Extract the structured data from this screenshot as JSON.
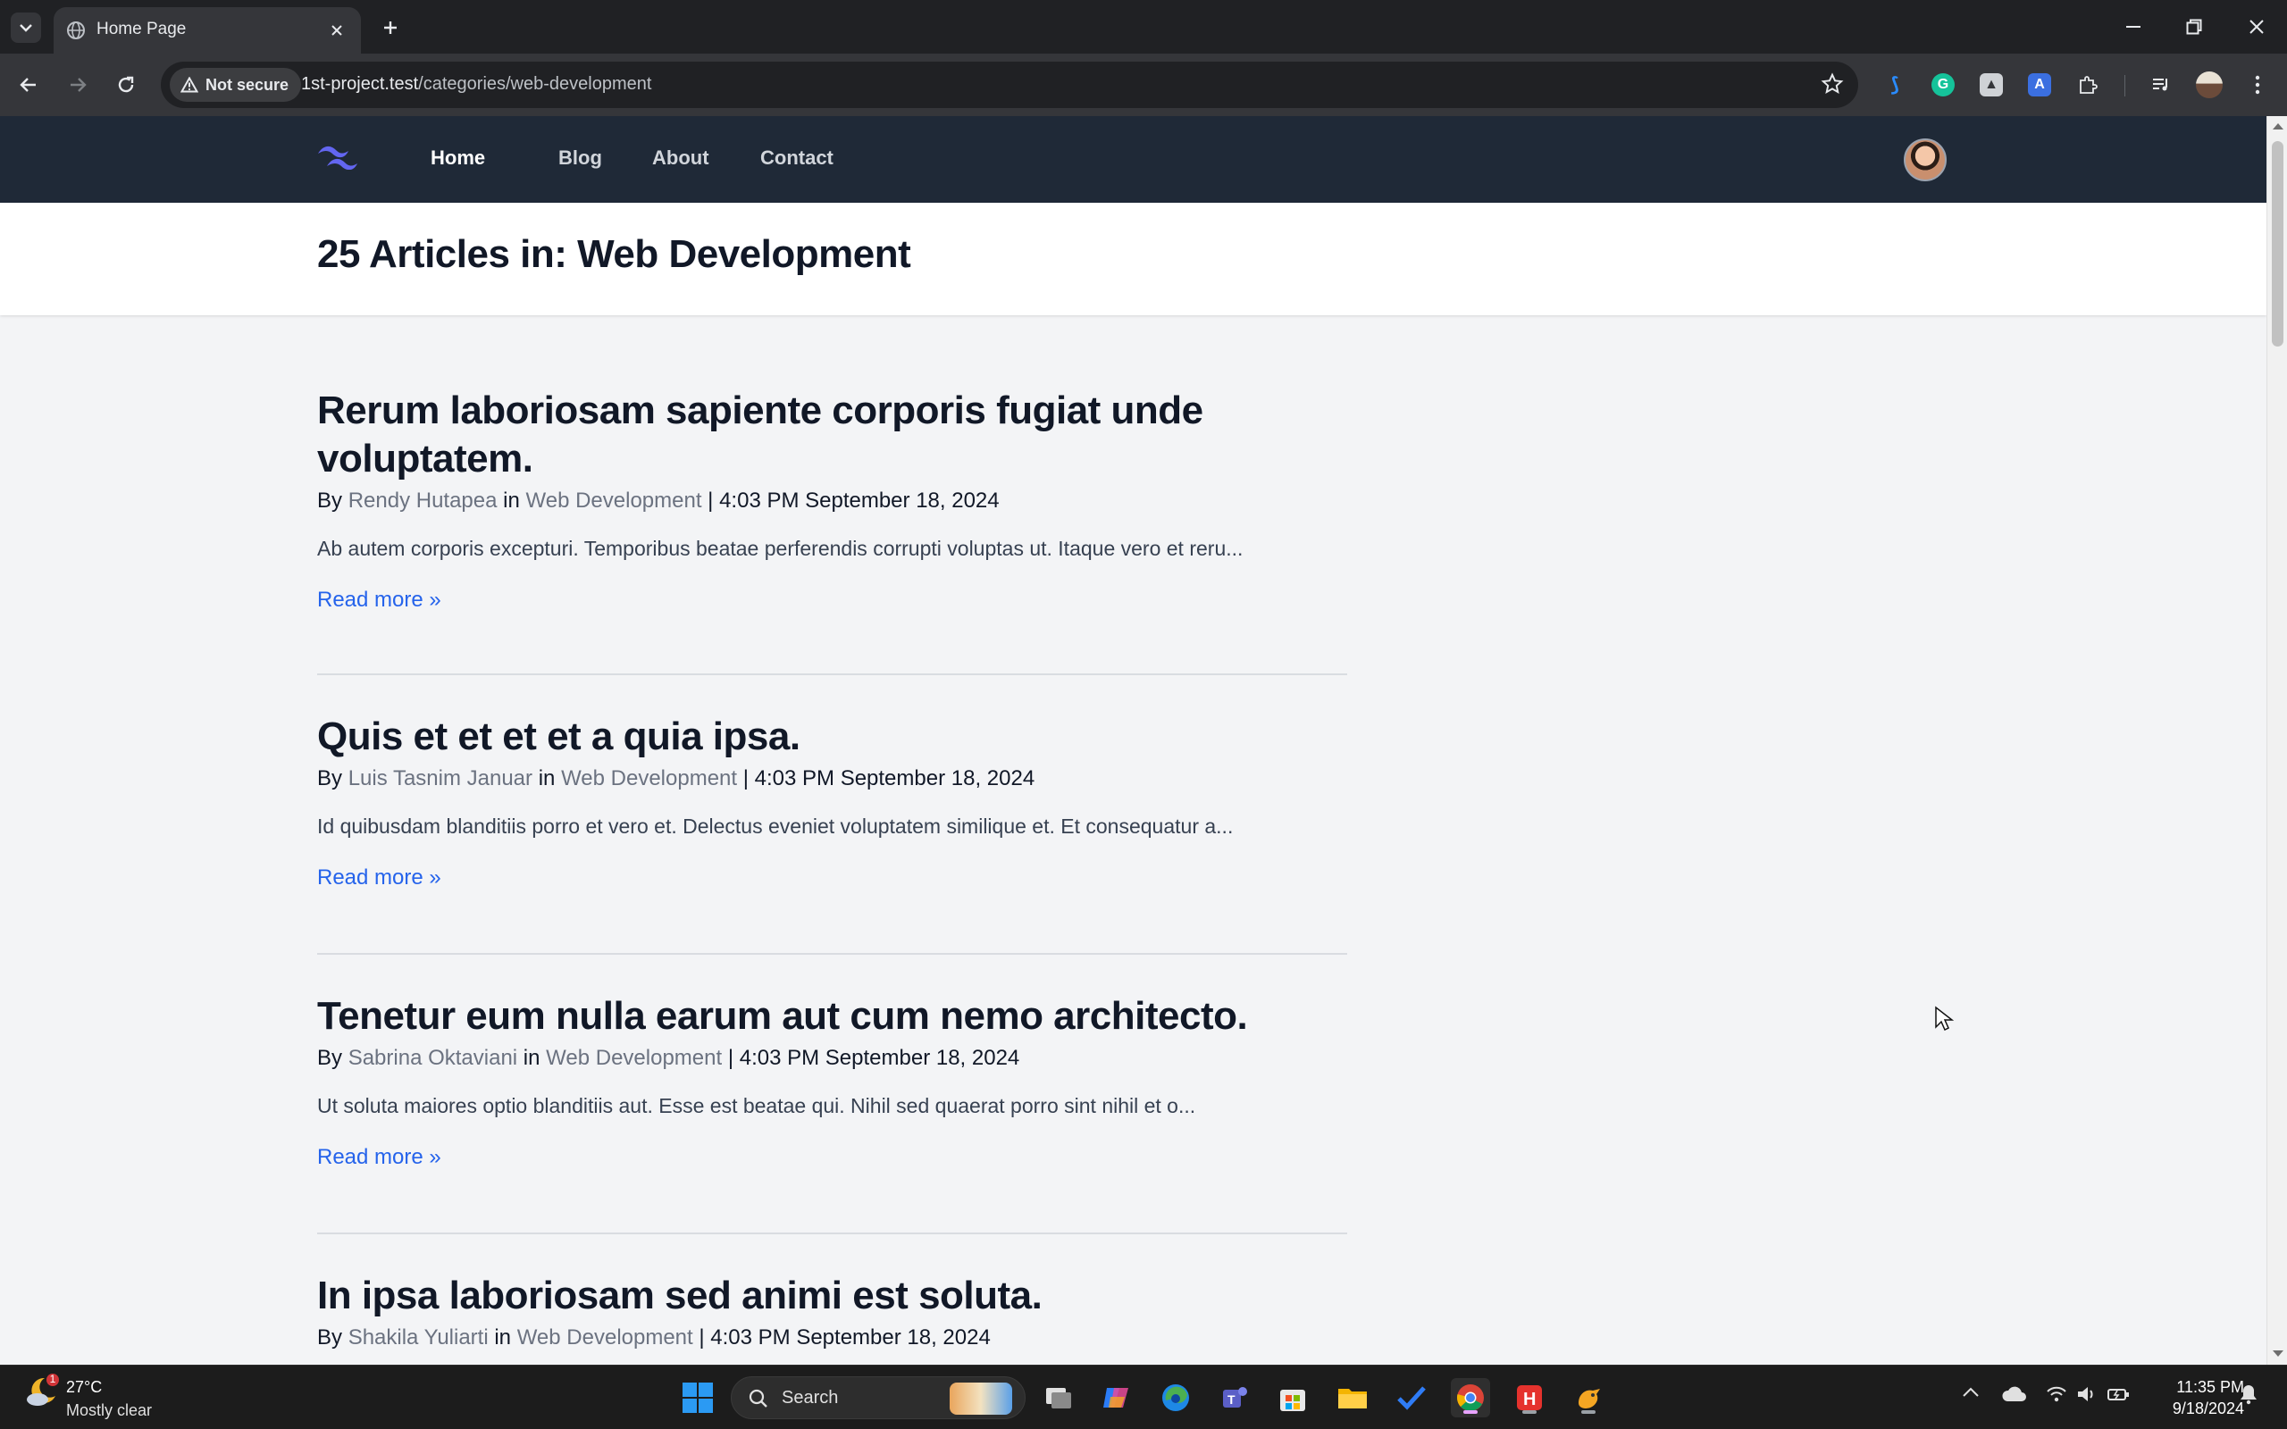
{
  "browser": {
    "tab_title": "Home Page",
    "security_label": "Not secure",
    "url_host": "1st-project.test",
    "url_path": "/categories/web-development"
  },
  "site": {
    "nav": {
      "items": [
        "Home",
        "Blog",
        "About",
        "Contact"
      ]
    },
    "header_title": "25 Articles in: Web Development"
  },
  "articles": [
    {
      "title_line1": "Rerum laboriosam sapiente corporis fugiat unde",
      "title_line2": "voluptatem.",
      "by": "By",
      "author": "Rendy Hutapea",
      "in": "in",
      "category": "Web Development",
      "date": "4:03 PM September 18, 2024",
      "excerpt": "Ab autem corporis excepturi. Temporibus beatae perferendis corrupti voluptas ut. Itaque vero et reru...",
      "read_more": "Read more »"
    },
    {
      "title_line1": "Quis et et et et a quia ipsa.",
      "by": "By",
      "author": "Luis Tasnim Januar",
      "in": "in",
      "category": "Web Development",
      "date": "4:03 PM September 18, 2024",
      "excerpt": "Id quibusdam blanditiis porro et vero et. Delectus eveniet voluptatem similique et. Et consequatur a...",
      "read_more": "Read more »"
    },
    {
      "title_line1": "Tenetur eum nulla earum aut cum nemo architecto.",
      "by": "By",
      "author": "Sabrina Oktaviani",
      "in": "in",
      "category": "Web Development",
      "date": "4:03 PM September 18, 2024",
      "excerpt": "Ut soluta maiores optio blanditiis aut. Esse est beatae qui. Nihil sed quaerat porro sint nihil et o...",
      "read_more": "Read more »"
    },
    {
      "title_line1": "In ipsa laboriosam sed animi est soluta.",
      "by": "By",
      "author": "Shakila Yuliarti",
      "in": "in",
      "category": "Web Development",
      "date": "4:03 PM September 18, 2024"
    }
  ],
  "taskbar": {
    "weather_temp": "27°C",
    "weather_cond": "Mostly clear",
    "weather_badge": "1",
    "search_label": "Search",
    "time": "11:35 PM",
    "date": "9/18/2024"
  },
  "colors": {
    "nav_bg": "#1f2937",
    "page_bg": "#f3f4f6",
    "link_blue": "#2563eb",
    "meta_gray": "#6b7280"
  }
}
